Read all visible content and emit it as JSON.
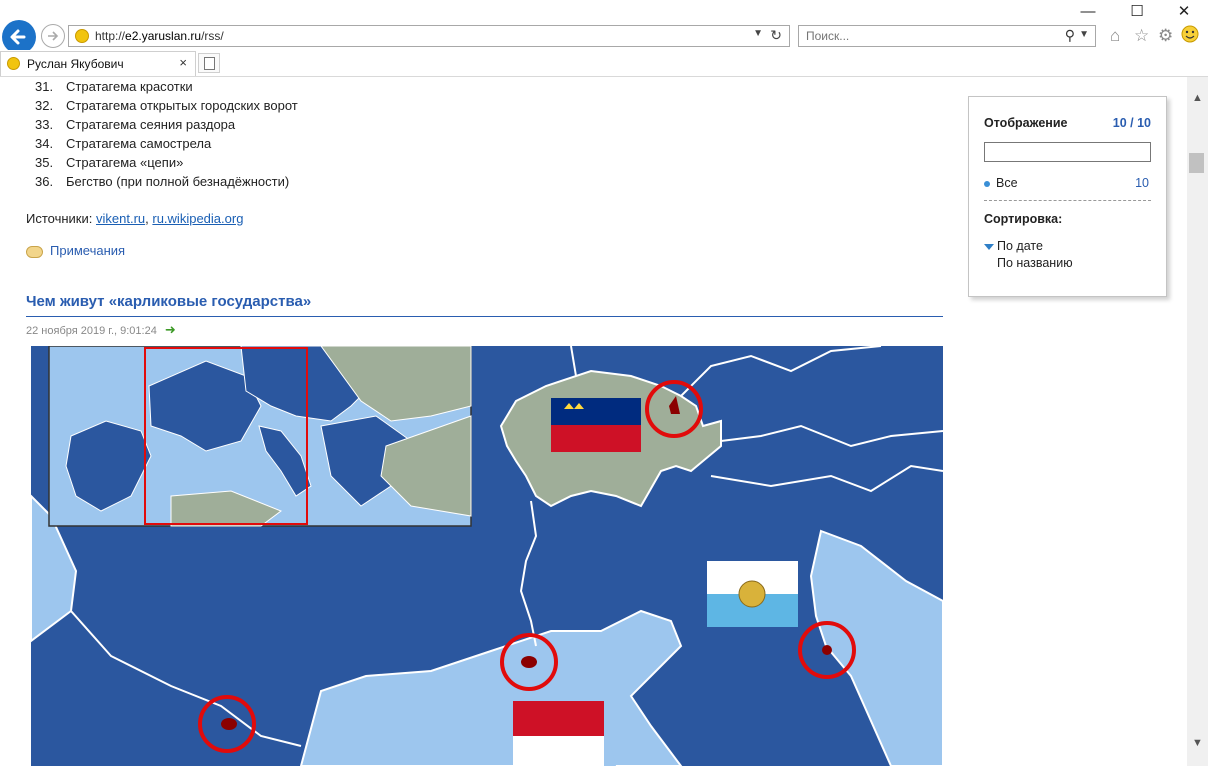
{
  "browser": {
    "url_prefix": "http://",
    "url_domain": "e2.yaruslan.ru",
    "url_path": "/rss/",
    "search_placeholder": "Поиск...",
    "tab_title": "Руслан Якубович"
  },
  "stratagems": [
    {
      "num": "31.",
      "text": "Стратагема красотки"
    },
    {
      "num": "32.",
      "text": "Стратагема открытых городских ворот"
    },
    {
      "num": "33.",
      "text": "Стратагема сеяния раздора"
    },
    {
      "num": "34.",
      "text": "Стратагема самострела"
    },
    {
      "num": "35.",
      "text": "Стратагема «цепи»"
    },
    {
      "num": "36.",
      "text": "Бегство (при полной безнадёжности)"
    }
  ],
  "sources": {
    "label": "Источники:",
    "link1": "vikent.ru",
    "link2": "ru.wikipedia.org"
  },
  "notes_link": "Примечания",
  "post": {
    "title": "Чем живут «карликовые государства»",
    "date": "22 ноября 2019 г., 9:01:24"
  },
  "panel": {
    "display_label": "Отображение",
    "display_count": "10 / 10",
    "filter_all": "Все",
    "filter_all_count": "10",
    "sort_label": "Сортировка:",
    "sort_by_date": "По дате",
    "sort_by_name": "По названию"
  },
  "colors": {
    "link": "#2a5db0",
    "map_sea": "#2b579f",
    "map_land_light": "#9dc6ee",
    "map_land_gray": "#9fae99",
    "highlight_red": "#e10b0b"
  }
}
